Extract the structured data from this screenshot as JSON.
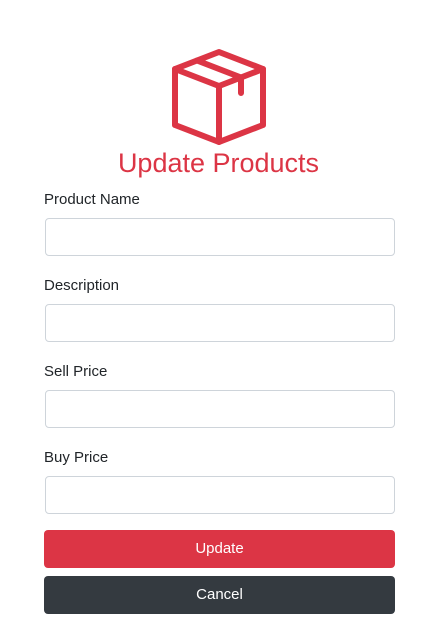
{
  "header": {
    "icon": "box-icon",
    "title": "Update Products",
    "accent_color": "#dc3545"
  },
  "form": {
    "fields": [
      {
        "label": "Product Name",
        "value": "",
        "placeholder": ""
      },
      {
        "label": "Description",
        "value": "",
        "placeholder": ""
      },
      {
        "label": "Sell Price",
        "value": "",
        "placeholder": ""
      },
      {
        "label": "Buy Price",
        "value": "",
        "placeholder": ""
      }
    ],
    "update_label": "Update",
    "cancel_label": "Cancel"
  },
  "colors": {
    "update_button": "#dc3545",
    "cancel_button": "#343a40"
  }
}
